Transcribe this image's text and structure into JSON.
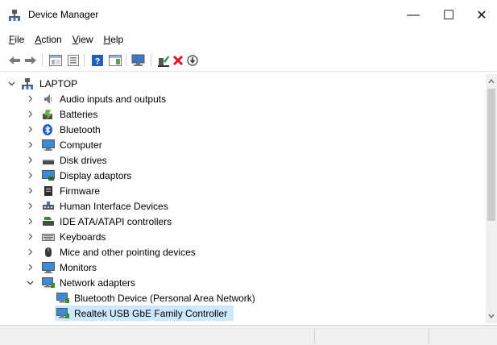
{
  "window": {
    "title": "Device Manager",
    "minimize_glyph": "—",
    "maximize_glyph": "☐",
    "close_glyph": "✕"
  },
  "menu": [
    {
      "mnemonic": "F",
      "rest": "ile"
    },
    {
      "mnemonic": "A",
      "rest": "ction"
    },
    {
      "mnemonic": "V",
      "rest": "iew"
    },
    {
      "mnemonic": "H",
      "rest": "elp"
    }
  ],
  "toolbar": {
    "icons": [
      "back-icon",
      "forward-icon",
      "show-hide-console-tree-icon",
      "properties-icon",
      "help-icon",
      "action-pane-icon",
      "scan-hardware-icon",
      "update-driver-icon",
      "uninstall-icon",
      "disable-device-icon"
    ]
  },
  "tree": {
    "root": {
      "label": "LAPTOP",
      "expanded": true,
      "icon": "computer-tree-icon"
    },
    "categories": [
      {
        "label": "Audio inputs and outputs",
        "icon": "speaker-icon",
        "expanded": false
      },
      {
        "label": "Batteries",
        "icon": "battery-icon",
        "expanded": false
      },
      {
        "label": "Bluetooth",
        "icon": "bluetooth-icon",
        "expanded": false
      },
      {
        "label": "Computer",
        "icon": "monitor-icon",
        "expanded": false
      },
      {
        "label": "Disk drives",
        "icon": "disk-drive-icon",
        "expanded": false
      },
      {
        "label": "Display adaptors",
        "icon": "display-adapter-icon",
        "expanded": false
      },
      {
        "label": "Firmware",
        "icon": "firmware-icon",
        "expanded": false
      },
      {
        "label": "Human Interface Devices",
        "icon": "hid-icon",
        "expanded": false
      },
      {
        "label": "IDE ATA/ATAPI controllers",
        "icon": "ide-controller-icon",
        "expanded": false
      },
      {
        "label": "Keyboards",
        "icon": "keyboard-icon",
        "expanded": false
      },
      {
        "label": "Mice and other pointing devices",
        "icon": "mouse-icon",
        "expanded": false
      },
      {
        "label": "Monitors",
        "icon": "monitor-icon",
        "expanded": false
      },
      {
        "label": "Network adapters",
        "icon": "network-adapter-icon",
        "expanded": true
      }
    ],
    "network_children": [
      {
        "label": "Bluetooth Device (Personal Area Network)",
        "icon": "network-adapter-icon",
        "selected": false
      },
      {
        "label": "Realtek USB GbE Family Controller",
        "icon": "network-adapter-icon",
        "selected": true
      }
    ]
  },
  "colors": {
    "selection": "#cce8ff",
    "status_bar": "#f0f0f0",
    "uninstall_red": "#e81123",
    "help_blue": "#1f5fbf",
    "adapter_blue": "#2c7bd6"
  }
}
